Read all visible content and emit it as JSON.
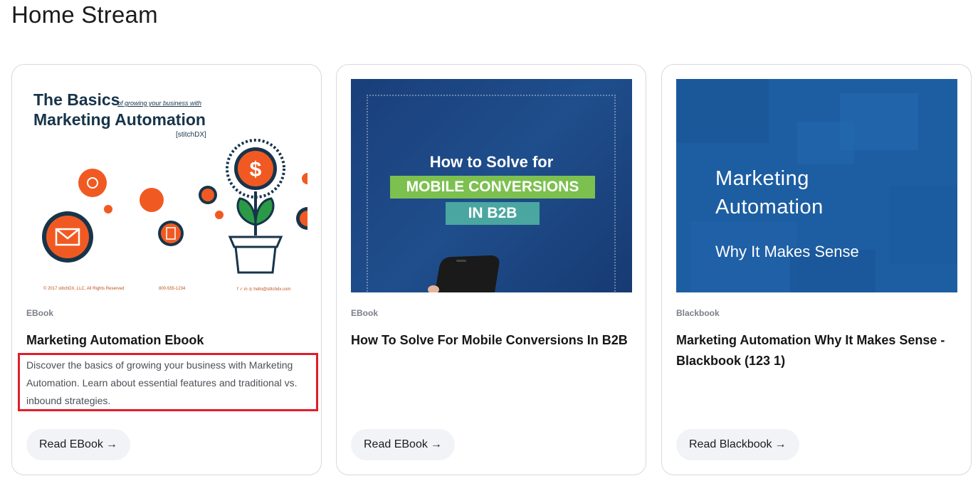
{
  "page": {
    "title": "Home Stream"
  },
  "cards": [
    {
      "thumb": {
        "title_line1": "The Basics",
        "subtitle": "of growing your business with",
        "title_line2": "Marketing Automation",
        "brand": "[stitchDX]",
        "footer_left": "© 2017 stitchDX, LLC. All Rights Reserved",
        "footer_mid": "800-555-1234",
        "footer_right": "f ✓ in ◎  hello@stitchdx.com"
      },
      "category": "EBook",
      "title": "Marketing Automation Ebook",
      "description": "Discover the basics of growing your business with Marketing Automation. Learn about essential features and traditional vs. inbound strategies.",
      "button_label": "Read EBook",
      "button_arrow": "→"
    },
    {
      "thumb": {
        "line1": "How to Solve for",
        "line2": "MOBILE CONVERSIONS",
        "line3": "IN B2B"
      },
      "category": "EBook",
      "title": "How To Solve For Mobile Conversions In B2B",
      "button_label": "Read EBook",
      "button_arrow": "→"
    },
    {
      "thumb": {
        "line1": "Marketing",
        "line2": "Automation",
        "line3": "Why It Makes Sense"
      },
      "category": "Blackbook",
      "title": "Marketing Automation Why It Makes Sense - Blackbook (123 1)",
      "button_label": "Read Blackbook",
      "button_arrow": "→"
    }
  ],
  "colors": {
    "highlight": "#e11d2a",
    "button_bg": "#f1f3f7",
    "thumb_orange": "#f05a22",
    "thumb_navy": "#17344a",
    "thumb_blue": "#1d5ea2"
  }
}
